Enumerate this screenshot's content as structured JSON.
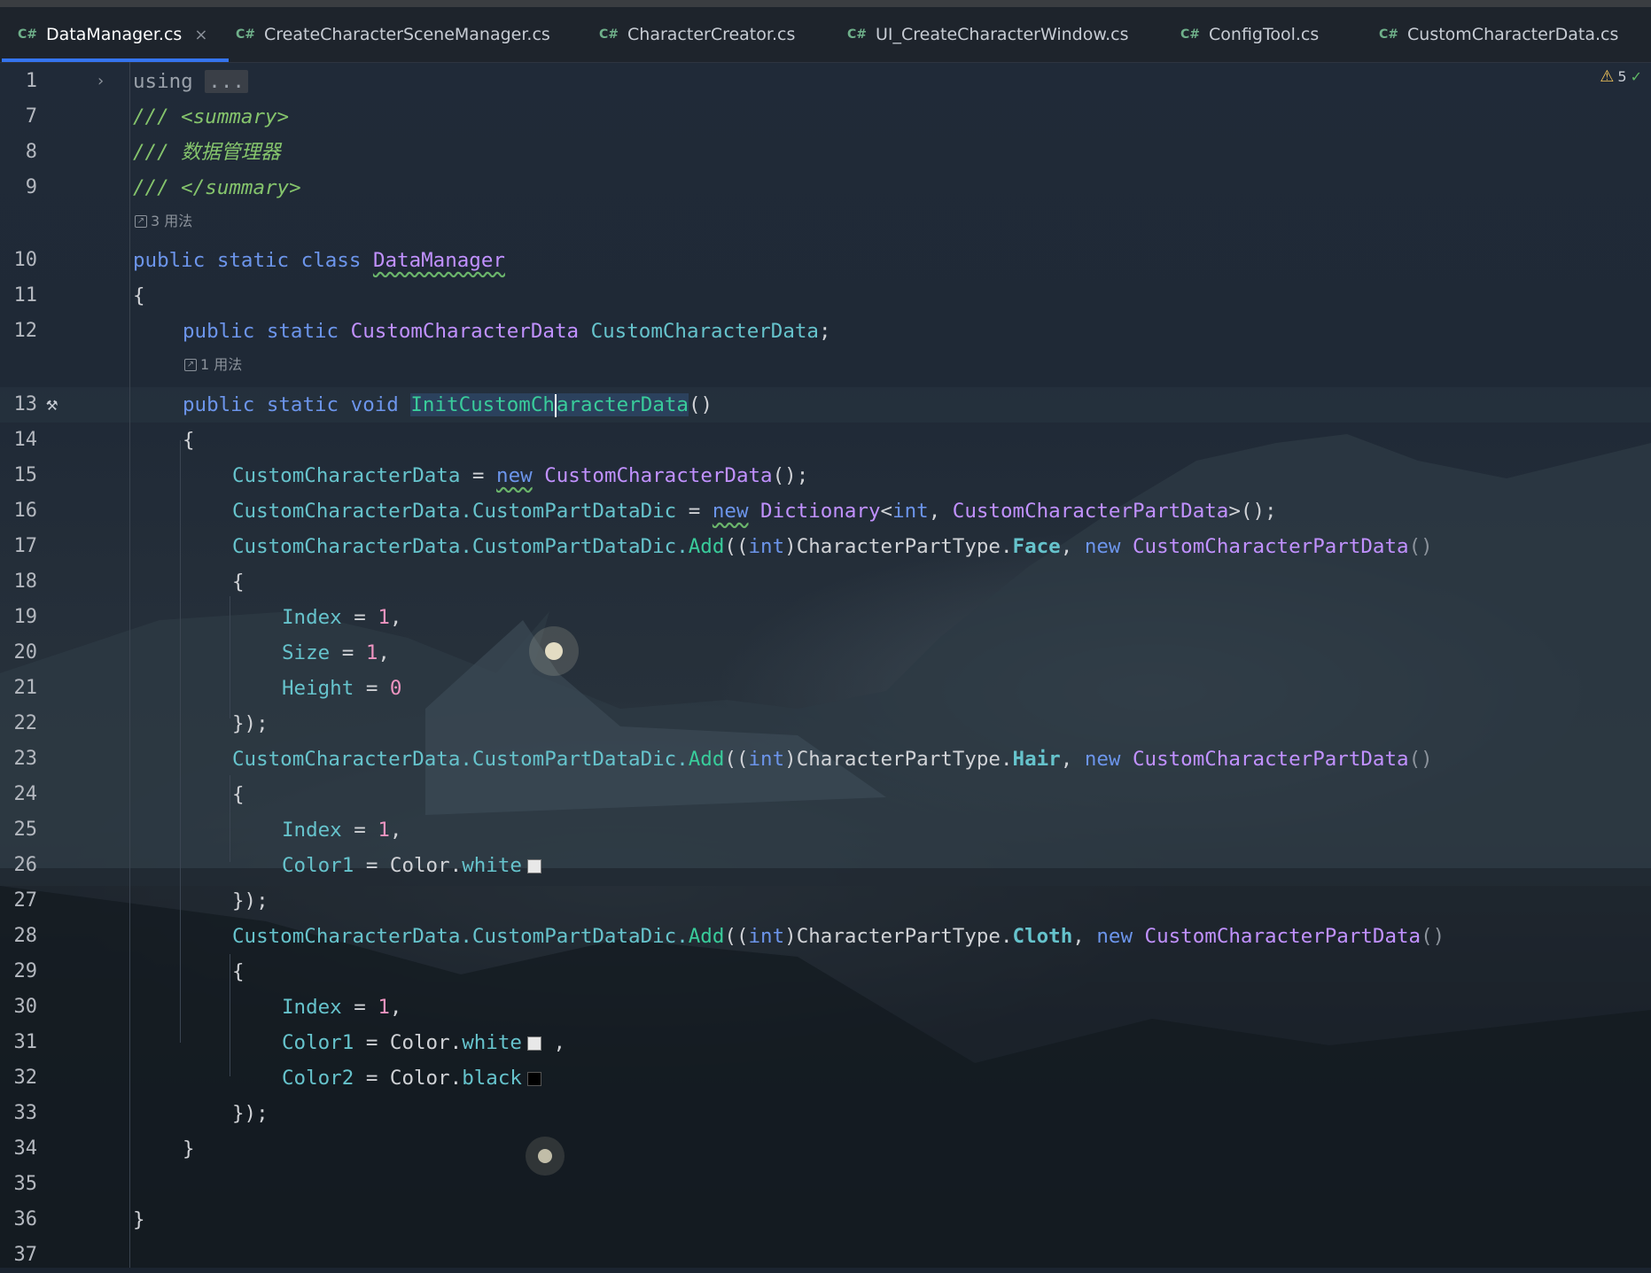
{
  "tabs": [
    {
      "label": "DataManager.cs",
      "active": true,
      "close": "×"
    },
    {
      "label": "CreateCharacterSceneManager.cs"
    },
    {
      "label": "CharacterCreator.cs"
    },
    {
      "label": "UI_CreateCharacterWindow.cs"
    },
    {
      "label": "ConfigTool.cs"
    },
    {
      "label": "CustomCharacterData.cs"
    }
  ],
  "tab_lang": "C#",
  "inspections": {
    "count": "5"
  },
  "hints": {
    "class_usages": "3 用法",
    "method_usages": "1 用法"
  },
  "code": {
    "l1": {
      "num": "1",
      "kw": "using",
      "collapsed": "..."
    },
    "l7": {
      "num": "7",
      "text": "/// <summary>"
    },
    "l8": {
      "num": "8",
      "text": "/// 数据管理器"
    },
    "l9": {
      "num": "9",
      "text": "/// </summary>"
    },
    "l10": {
      "num": "10",
      "kw": "public static class",
      "name": "DataManager"
    },
    "l11": {
      "num": "11",
      "text": "{"
    },
    "l12": {
      "num": "12",
      "kw": "public static",
      "type": "CustomCharacterData",
      "field": "CustomCharacterData",
      "end": ";"
    },
    "l13": {
      "num": "13",
      "kw": "public static void",
      "name_a": "InitCustomCh",
      "name_b": "aracterData",
      "end": "()"
    },
    "l14": {
      "num": "14",
      "text": "{"
    },
    "l15": {
      "num": "15",
      "field": "CustomCharacterData",
      "eq": " = ",
      "kw": "new",
      "type": "CustomCharacterData",
      "end": "();"
    },
    "l16": {
      "num": "16",
      "field": "CustomCharacterData.CustomPartDataDic",
      "eq": " = ",
      "kw": "new",
      "type": "Dictionary",
      "lt": "<",
      "int": "int",
      "comma": ", ",
      "type2": "CustomCharacterPartData",
      "end": ">();"
    },
    "l17": {
      "num": "17",
      "field": "CustomCharacterData.CustomPartDataDic.",
      "method": "Add",
      "open": "((",
      "int": "int",
      "close": ")",
      "enumtype": "CharacterPartType.",
      "enumval": "Face",
      "comma": ", ",
      "kw": "new",
      "type": "CustomCharacterPartData",
      "end": "()"
    },
    "l18": {
      "num": "18",
      "text": "{"
    },
    "l19": {
      "num": "19",
      "field": "Index",
      "eq": " = ",
      "val": "1",
      "end": ","
    },
    "l20": {
      "num": "20",
      "field": "Size",
      "eq": " = ",
      "val": "1",
      "end": ","
    },
    "l21": {
      "num": "21",
      "field": "Height",
      "eq": " = ",
      "val": "0"
    },
    "l22": {
      "num": "22",
      "text": "});"
    },
    "l23": {
      "num": "23",
      "field": "CustomCharacterData.CustomPartDataDic.",
      "method": "Add",
      "open": "((",
      "int": "int",
      "close": ")",
      "enumtype": "CharacterPartType.",
      "enumval": "Hair",
      "comma": ", ",
      "kw": "new",
      "type": "CustomCharacterPartData",
      "end": "()"
    },
    "l24": {
      "num": "24",
      "text": "{"
    },
    "l25": {
      "num": "25",
      "field": "Index",
      "eq": " = ",
      "val": "1",
      "end": ","
    },
    "l26": {
      "num": "26",
      "field": "Color1",
      "eq": " = ",
      "obj": "Color.",
      "prop": "white"
    },
    "l27": {
      "num": "27",
      "text": "});"
    },
    "l28": {
      "num": "28",
      "field": "CustomCharacterData.CustomPartDataDic.",
      "method": "Add",
      "open": "((",
      "int": "int",
      "close": ")",
      "enumtype": "CharacterPartType.",
      "enumval": "Cloth",
      "comma": ", ",
      "kw": "new",
      "type": "CustomCharacterPartData",
      "end": "()"
    },
    "l29": {
      "num": "29",
      "text": "{"
    },
    "l30": {
      "num": "30",
      "field": "Index",
      "eq": " = ",
      "val": "1",
      "end": ","
    },
    "l31": {
      "num": "31",
      "field": "Color1",
      "eq": " = ",
      "obj": "Color.",
      "prop": "white",
      "end": " ,"
    },
    "l32": {
      "num": "32",
      "field": "Color2",
      "eq": " = ",
      "obj": "Color.",
      "prop": "black"
    },
    "l33": {
      "num": "33",
      "text": "});"
    },
    "l34": {
      "num": "34",
      "text": "}"
    },
    "l35": {
      "num": "35",
      "text": ""
    },
    "l36": {
      "num": "36",
      "text": "}"
    },
    "l37": {
      "num": "37",
      "text": ""
    }
  },
  "colors": {
    "accent": "#3574f0",
    "keyword": "#6c95eb",
    "type": "#c191ff",
    "field": "#66c3cc",
    "method": "#39cc9b",
    "number": "#ed94c0",
    "comment": "#85c46c"
  }
}
